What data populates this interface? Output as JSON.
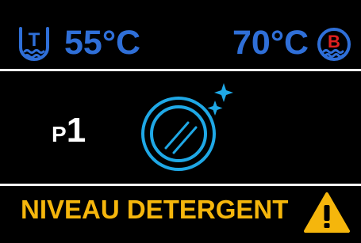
{
  "header": {
    "wash_temp": "55°C",
    "boiler_temp": "70°C",
    "wash_tank_icon": {
      "icon": "wash-tank-icon",
      "letter": "T",
      "color": "#2f6fd8"
    },
    "boiler_icon": {
      "icon": "boiler-icon",
      "letter": "B",
      "color": "#e02020"
    }
  },
  "program": {
    "prefix": "P",
    "number": "1",
    "icon": "clean-plate-icon",
    "icon_color": "#1fa8e6"
  },
  "alert": {
    "message": "NIVEAU DETERGENT",
    "icon": "warning-icon",
    "color": "#f5b60c"
  }
}
